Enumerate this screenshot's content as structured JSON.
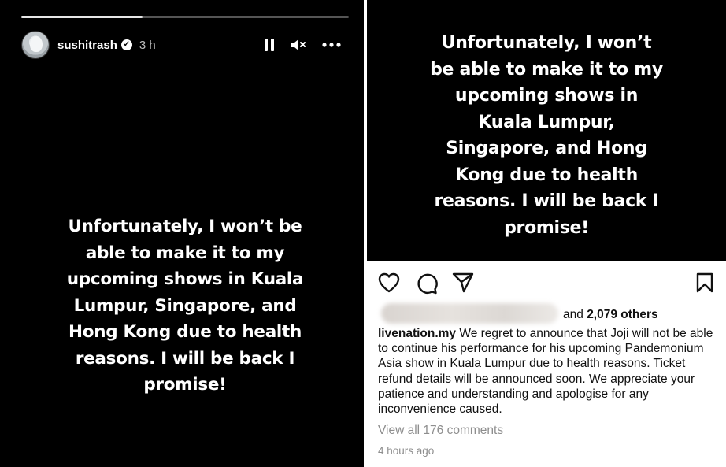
{
  "story": {
    "progress": 0.37,
    "username": "sushitrash",
    "time": "3 h",
    "text": "Unfortunately, I won’t be able to make it to my upcoming shows in Kuala Lumpur, Singapore, and Hong Kong due to health reasons. I will be back I promise!",
    "icons": [
      "pause-icon",
      "mute-icon",
      "more-icon",
      "verified-badge-icon"
    ]
  },
  "story_crop": {
    "text": "Unfortunately, I won’t be able to make it to my upcoming shows in Kuala Lumpur, Singapore, and Hong Kong due to health reasons. I will be back I promise!"
  },
  "post": {
    "icons": [
      "heart-icon",
      "comment-icon",
      "share-icon",
      "bookmark-icon"
    ],
    "likes_prefix": "and",
    "likes_count": "2,079 others",
    "caption_handle": "livenation.my",
    "caption_text": " We regret to announce that Joji will not be able to continue his performance for his upcoming Pandemonium Asia show in Kuala Lumpur due to health reasons. Ticket refund details will be announced soon. We appreciate your patience and understanding and apologise for any inconvenience caused.",
    "view_comments": "View all 176 comments",
    "time": "4 hours ago"
  },
  "colors": {
    "story_bg": "#000000",
    "secondary_text": "#8e8e8e",
    "progress_track": "#555555",
    "progress_fill": "#e6e6e6"
  }
}
